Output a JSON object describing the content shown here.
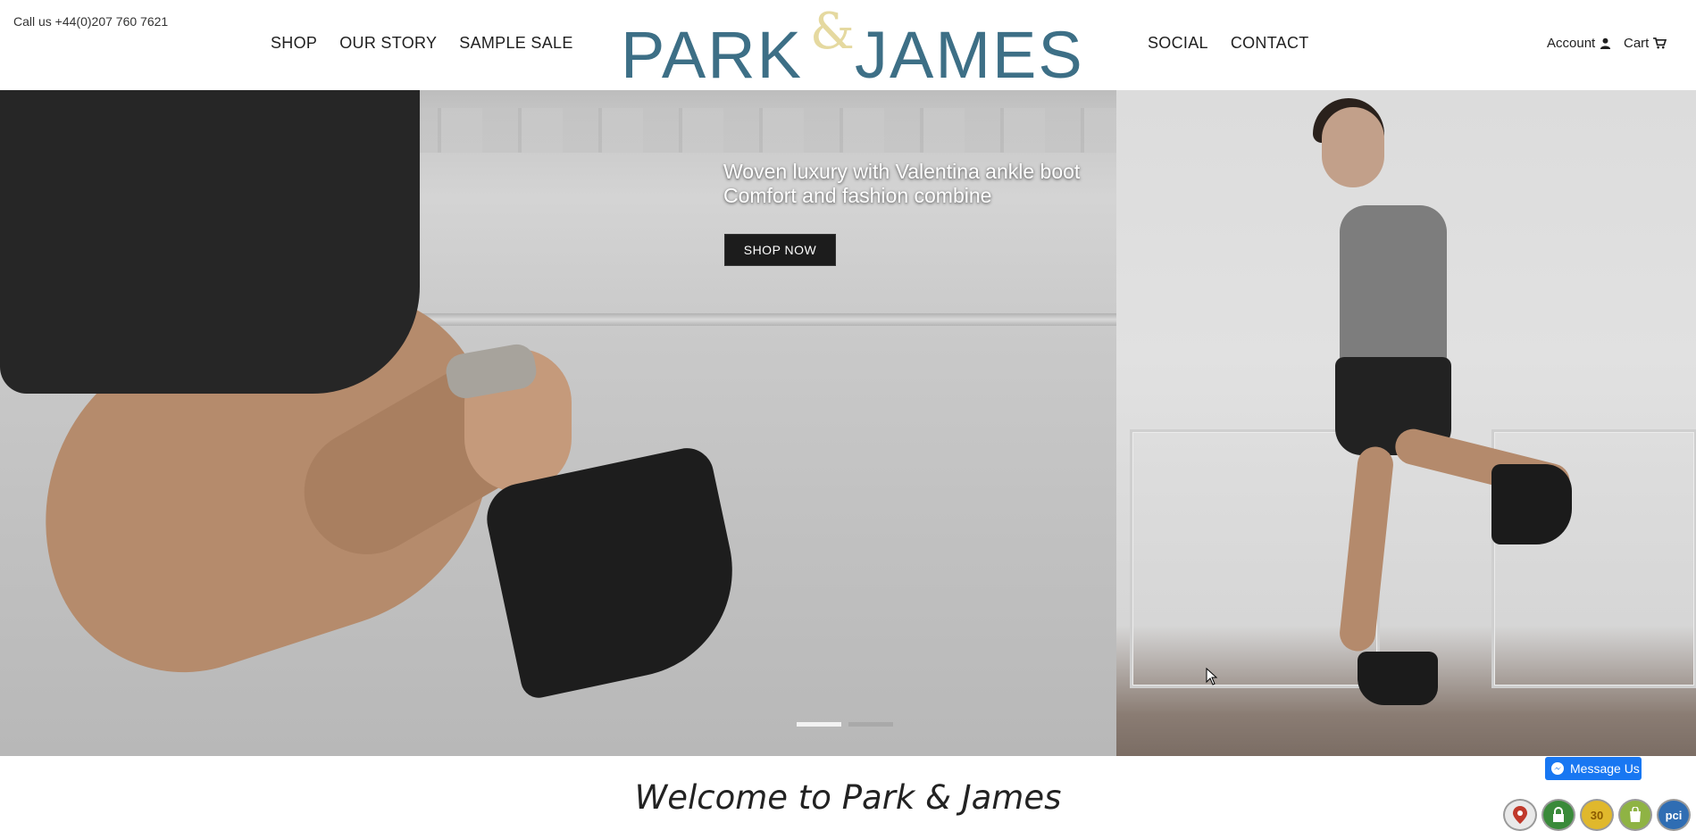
{
  "header": {
    "phone": "Call us +44(0)207 760 7621",
    "nav_left": [
      "SHOP",
      "OUR STORY",
      "SAMPLE SALE"
    ],
    "nav_right": [
      "SOCIAL",
      "CONTACT"
    ],
    "logo": {
      "left": "PARK",
      "amp": "&",
      "right": "JAMES"
    },
    "account_label": "Account",
    "cart_label": "Cart"
  },
  "hero": {
    "caption_line1": "Woven luxury with Valentina ankle boot",
    "caption_line2": "Comfort and fashion combine",
    "button_label": "SHOP NOW",
    "slides_total": 2,
    "active_slide": 1
  },
  "welcome": {
    "title": "Welcome to Park & James"
  },
  "widgets": {
    "message_us": "Message Us",
    "badges": [
      {
        "icon": "map-pin-icon",
        "color": "#b33"
      },
      {
        "icon": "lock-icon",
        "color": "#3a8a3a"
      },
      {
        "icon": "30-badge-icon",
        "label": "30",
        "color": "#e0b82c"
      },
      {
        "icon": "shopify-bag-icon",
        "color": "#8fb344"
      },
      {
        "icon": "pci-icon",
        "label": "pci",
        "color": "#2f6db3"
      }
    ]
  },
  "colors": {
    "logo_blue": "#3d6f86",
    "logo_amp": "#e5d9a0",
    "messenger_blue": "#1877f2"
  }
}
